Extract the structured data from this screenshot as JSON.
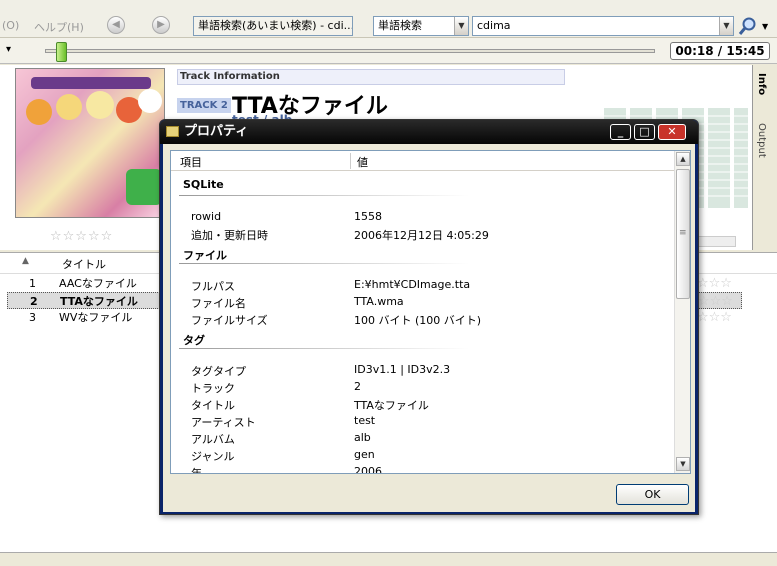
{
  "toolbar": {
    "menu_partial": "(O)",
    "menu_help": "ヘルプ(H)",
    "nav_back": "◀",
    "nav_forward": "▶",
    "tab_combo": "単語検索(あいまい検索) - cdi...",
    "search_mode": "単語検索",
    "search_value": "cdima",
    "dropdown_glyph": "▼",
    "sidebar_dropdown_glyph": "▾"
  },
  "player": {
    "time": "00:18 / 15:45",
    "progress_fraction": 0.02
  },
  "info": {
    "header": "Track Information",
    "track_badge": "TRACK 2",
    "track_title": "TTAなファイル",
    "track_sub": "test / alb",
    "stars": "☆☆☆☆☆",
    "side_tab_info": "Info",
    "side_tab_output": "Output"
  },
  "list": {
    "col_sort": "▲",
    "col_title": "タイトル",
    "rows": [
      {
        "no": "1",
        "title": "AACなファイル",
        "stars": "☆☆☆",
        "selected": false
      },
      {
        "no": "2",
        "title": "TTAなファイル",
        "stars": "☆☆☆",
        "selected": true
      },
      {
        "no": "3",
        "title": "WVなファイル",
        "stars": "☆☆☆",
        "selected": false
      }
    ]
  },
  "dialog": {
    "title": "プロパティ",
    "btn_min": "_",
    "btn_max": "□",
    "btn_close": "✕",
    "col_item": "項目",
    "col_value": "値",
    "groups": [
      {
        "name": "SQLite",
        "props": [
          {
            "k": "rowid",
            "v": "1558"
          },
          {
            "k": "追加・更新日時",
            "v": "2006年12月12日 4:05:29"
          }
        ]
      },
      {
        "name": "ファイル",
        "props": [
          {
            "k": "フルパス",
            "v": "E:¥hmt¥CDImage.tta"
          },
          {
            "k": "ファイル名",
            "v": "TTA.wma"
          },
          {
            "k": "ファイルサイズ",
            "v": "100 バイト (100 バイト)"
          }
        ]
      },
      {
        "name": "タグ",
        "props": [
          {
            "k": "タグタイプ",
            "v": "ID3v1.1 | ID3v2.3"
          },
          {
            "k": "トラック",
            "v": "2"
          },
          {
            "k": "タイトル",
            "v": "TTAなファイル"
          },
          {
            "k": "アーティスト",
            "v": "test"
          },
          {
            "k": "アルバム",
            "v": "alb"
          },
          {
            "k": "ジャンル",
            "v": "gen"
          },
          {
            "k": "年",
            "v": "2006"
          }
        ]
      }
    ],
    "ok": "OK",
    "scroll_up": "▲",
    "scroll_down": "▼",
    "thumb_grip": "≡"
  },
  "colors": {
    "selected_row": "#dcdcdc",
    "titlebar": "#000000",
    "close_btn": "#c8332a"
  }
}
